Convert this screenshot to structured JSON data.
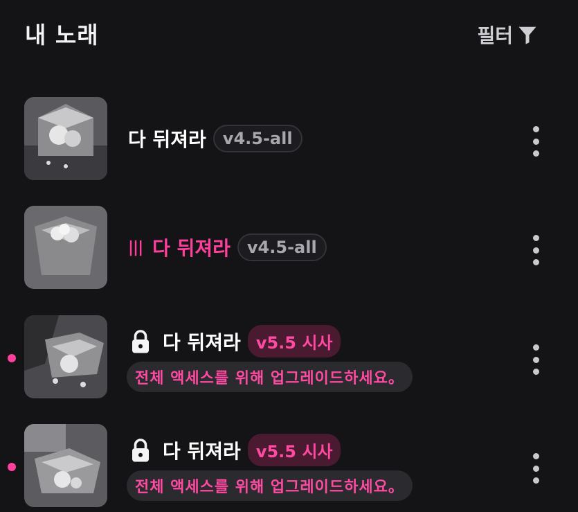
{
  "header": {
    "title": "내 노래",
    "filter_label": "필터",
    "filter_icon": "funnel-icon"
  },
  "colors": {
    "accent": "#ff3f9c",
    "background": "#141316"
  },
  "songs": [
    {
      "title": "다 뒤져라",
      "version": "v4.5-all",
      "locked": false,
      "playing": false,
      "upgrade_text": ""
    },
    {
      "title": "다 뒤져라",
      "version": "v4.5-all",
      "locked": false,
      "playing": true,
      "upgrade_text": ""
    },
    {
      "title": "다 뒤져라",
      "version": "v5.5 시사",
      "locked": true,
      "playing": false,
      "upgrade_text": "전체 액세스를 위해 업그레이드하세요。"
    },
    {
      "title": "다 뒤져라",
      "version": "v5.5 시사",
      "locked": true,
      "playing": false,
      "upgrade_text": "전체 액세스를 위해 업그레이드하세요。"
    }
  ]
}
